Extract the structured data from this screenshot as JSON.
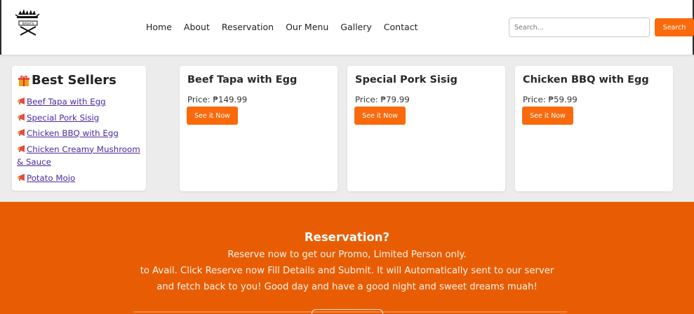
{
  "brand": {
    "logo_icon": "grill-logo-icon",
    "logo_text": "BASH'S"
  },
  "nav": {
    "links": [
      "Home",
      "About",
      "Reservation",
      "Our Menu",
      "Gallery",
      "Contact"
    ]
  },
  "search": {
    "placeholder": "Search...",
    "value": "",
    "button_label": "Search"
  },
  "best_sellers": {
    "title": "Best Sellers",
    "title_icon": "gift-icon",
    "item_icon": "megaphone-icon",
    "items": [
      "Beef Tapa with Egg",
      "Special Pork Sisig",
      "Chicken BBQ with Egg",
      "Chicken Creamy Mushroom & Sauce",
      "Potato Mojo"
    ]
  },
  "products": [
    {
      "name": "Beef Tapa with Egg",
      "price": "Price: ₱149.99",
      "button": "See it Now"
    },
    {
      "name": "Special Pork Sisig",
      "price": "Price: ₱79.99",
      "button": "See it Now"
    },
    {
      "name": "Chicken BBQ with Egg",
      "price": "Price: ₱59.99",
      "button": "See it Now"
    }
  ],
  "reservation": {
    "title": "Reservation?",
    "lines": [
      "Reserve now to get our Promo, Limited Person only.",
      "to Avail. Click Reserve now Fill Details and Submit. It will Automatically sent to our server",
      "and fetch back to you! Good day and have a good night and sweet dreams muah!"
    ]
  },
  "colors": {
    "accent": "#fa6a0c",
    "banner": "#e85d04",
    "link": "#4b2aa0",
    "background": "#ececec"
  }
}
